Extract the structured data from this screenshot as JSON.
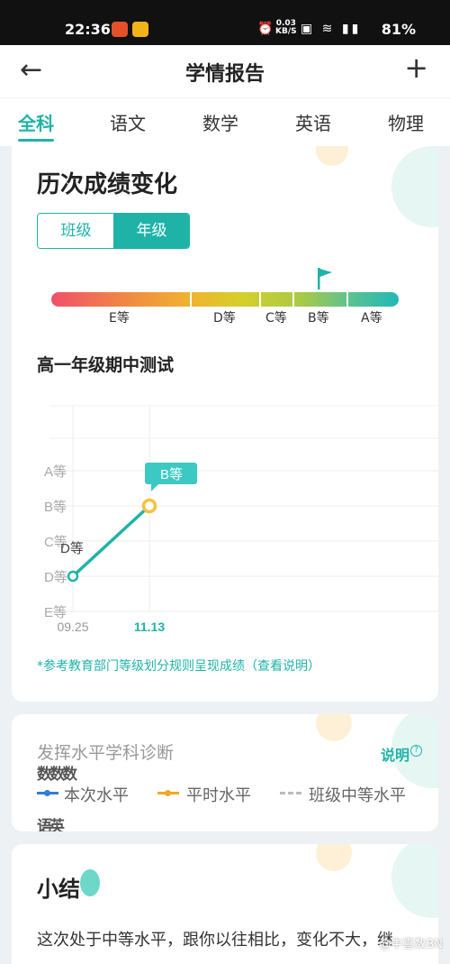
{
  "status_bar": {
    "time": "22:36",
    "speed_value": "0.03",
    "speed_unit": "KB/S",
    "icons": "⏰ HD ≈ 5G",
    "battery": "81%"
  },
  "header": {
    "title": "学情报告",
    "back_icon": "arrow-left-icon",
    "add_icon": "plus-icon"
  },
  "tabs": [
    {
      "label": "全科",
      "active": true
    },
    {
      "label": "语文",
      "active": false
    },
    {
      "label": "数学",
      "active": false
    },
    {
      "label": "英语",
      "active": false
    },
    {
      "label": "物理",
      "active": false
    }
  ],
  "history_card": {
    "title": "历次成绩变化",
    "toggle": {
      "class_label": "班级",
      "grade_label": "年级",
      "selected": "年级"
    },
    "grade_scale": {
      "labels": [
        "E等",
        "D等",
        "C等",
        "B等",
        "A等"
      ],
      "current": "B等"
    },
    "exam_title": "高一年级期中测试",
    "note": "*参考教育部门等级划分规则呈现成绩（查看说明）"
  },
  "chart_data": {
    "type": "line",
    "y_categories": [
      "E等",
      "D等",
      "C等",
      "B等",
      "A等"
    ],
    "x": [
      "09.25",
      "11.13"
    ],
    "series": [
      {
        "values": [
          "D等",
          "B等"
        ],
        "color": "#1fb3a8"
      }
    ],
    "point_labels": [
      "D等",
      "B等"
    ],
    "highlight_x": "11.13"
  },
  "diagnosis_card": {
    "title": "发挥水平学科诊断",
    "help_link": "说明",
    "garbled_text_1": "数数数",
    "legend": [
      {
        "label": "本次水平",
        "color": "#2f7fd4"
      },
      {
        "label": "平时水平",
        "color": "#f0a829"
      },
      {
        "label": "班级中等水平",
        "color": "#bbbbbb"
      }
    ],
    "garbled_text_2": "语英"
  },
  "summary_card": {
    "title": "小结",
    "body": "这次处于中等水平，跟你以往相比，变化不大，继"
  },
  "watermark": "@中喜数BN"
}
